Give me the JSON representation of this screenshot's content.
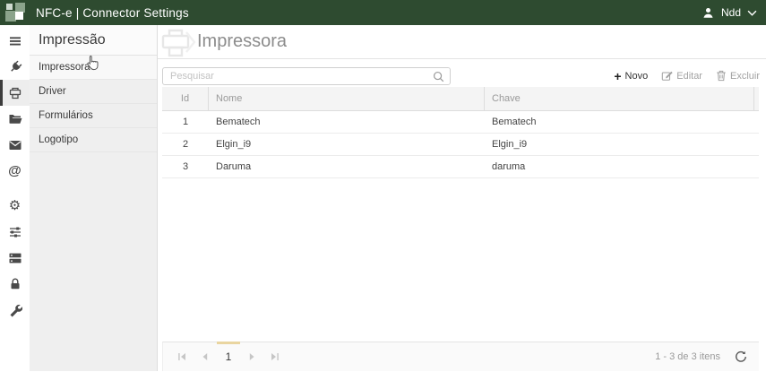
{
  "topbar": {
    "title": "NFC-e | Connector Settings",
    "user_label": "Ndd"
  },
  "rail": {
    "icons": [
      "menu",
      "plug",
      "printer",
      "folder-open",
      "mail",
      "at-sign",
      "gear",
      "sliders",
      "server",
      "lock",
      "wrench"
    ],
    "selected": "printer"
  },
  "sidebar": {
    "header": "Impressão",
    "items": [
      {
        "label": "Impressora",
        "selected": true
      },
      {
        "label": "Driver",
        "selected": false
      },
      {
        "label": "Formulários",
        "selected": false
      },
      {
        "label": "Logotipo",
        "selected": false
      }
    ]
  },
  "main": {
    "title": "Impressora",
    "search": {
      "placeholder": "Pesquisar",
      "value": ""
    },
    "toolbar": {
      "new_label": "Novo",
      "edit_label": "Editar",
      "delete_label": "Excluir"
    },
    "table": {
      "columns": [
        "Id",
        "Nome",
        "Chave"
      ],
      "rows": [
        [
          "1",
          "Bematech",
          "Bematech"
        ],
        [
          "2",
          "Elgin_i9",
          "Elgin_i9"
        ],
        [
          "3",
          "Daruma",
          "daruma"
        ]
      ]
    },
    "pagination": {
      "current_page": "1",
      "items_info": "1 - 3 de 3 itens"
    }
  },
  "colors": {
    "topbar_bg": "#2e4b30",
    "page_indicator": "#e9d5a0",
    "rail_selected_border": "#3c3c3c"
  }
}
